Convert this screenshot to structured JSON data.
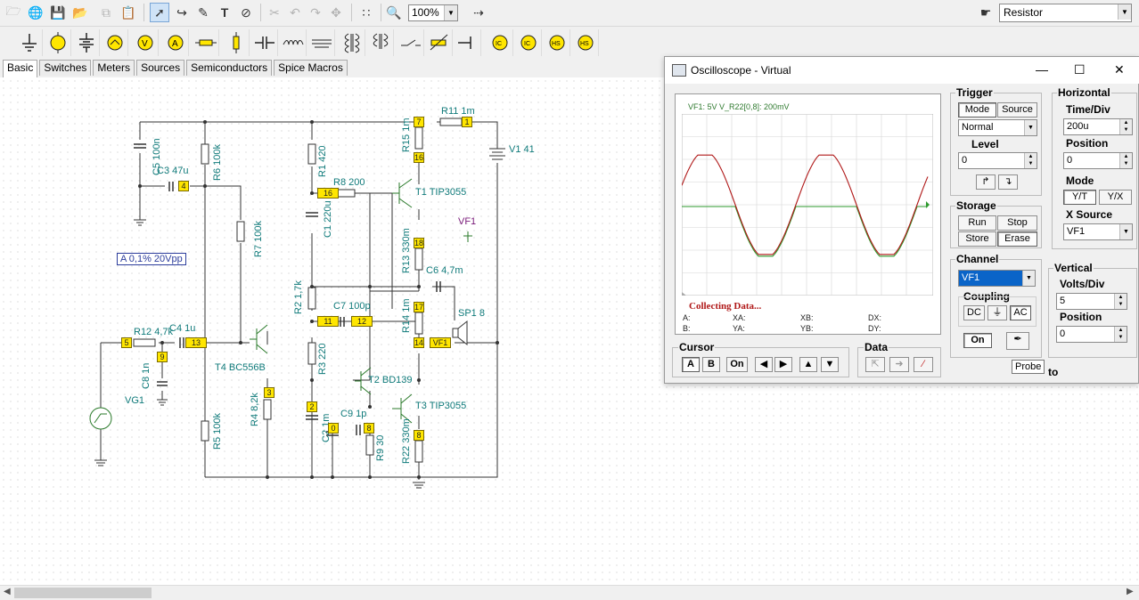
{
  "toolbar": {
    "zoom": "100%",
    "component_select": "Resistor",
    "icons": [
      "open-icon",
      "globe-icon",
      "save-icon",
      "open-folder-icon",
      "copy-icon",
      "paste-icon",
      "pointer-icon",
      "wire-icon",
      "pencil-icon",
      "text-icon",
      "no-wire-icon",
      "cut-icon",
      "undo-icon",
      "redo-icon",
      "pan-icon",
      "grid-icon",
      "zoom-icon",
      "marker-icon",
      "component-pick-icon"
    ]
  },
  "palette": {
    "items": [
      "ground-icon",
      "voltage-source-icon",
      "battery-icon",
      "ac-source-icon",
      "voltmeter-icon",
      "ammeter-icon",
      "resistor-icon",
      "potentiometer-icon",
      "capacitor-icon",
      "inductor-icon",
      "transformer-coil-icon",
      "transformer-icon",
      "transformer2-icon",
      "switch-icon",
      "variable-resistor-icon",
      "capacitor-polar-icon",
      "ic-icon",
      "ic2-icon",
      "hs-icon",
      "hs2-icon"
    ]
  },
  "tabs": [
    "Basic",
    "Switches",
    "Meters",
    "Sources",
    "Semiconductors",
    "Spice Macros"
  ],
  "schematic": {
    "source_label": "A 0,1% 20Vpp",
    "labels": [
      {
        "t": "R11 1m"
      },
      {
        "t": "V1 41"
      },
      {
        "t": "T1 TIP3055"
      },
      {
        "t": "R8 200"
      },
      {
        "t": "VF1"
      },
      {
        "t": "C6 4,7m"
      },
      {
        "t": "C7 100p"
      },
      {
        "t": "SP1 8"
      },
      {
        "t": "T4 BC556B"
      },
      {
        "t": "T2 BD139"
      },
      {
        "t": "T3 TIP3055"
      },
      {
        "t": "C9 1p"
      },
      {
        "t": "R12 4,7k"
      },
      {
        "t": "C4 1u"
      },
      {
        "t": "VG1"
      },
      {
        "t": "C3 47u"
      }
    ],
    "vlabels": [
      {
        "t": "C5 100n"
      },
      {
        "t": "R6 100k"
      },
      {
        "t": "R1 420"
      },
      {
        "t": "R15 1m"
      },
      {
        "t": "C1 220u"
      },
      {
        "t": "R7 100k"
      },
      {
        "t": "R13 330m"
      },
      {
        "t": "R2 1,7k"
      },
      {
        "t": "R14 1m"
      },
      {
        "t": "R3 220"
      },
      {
        "t": "R4 8,2k"
      },
      {
        "t": "R5 100k"
      },
      {
        "t": "C8 1n"
      },
      {
        "t": "R9 30"
      },
      {
        "t": "R22 330m"
      },
      {
        "t": "C2 1m"
      }
    ],
    "nodes": [
      "7",
      "1",
      "16",
      "16",
      "18",
      "17",
      "11",
      "12",
      "14",
      "VF1",
      "3",
      "2",
      "0",
      "8",
      "8",
      "5",
      "9",
      "13",
      "4"
    ]
  },
  "oscilloscope": {
    "title": "Oscilloscope - Virtual",
    "header": "VF1: 5V   V_R22[0,8]: 200mV",
    "status": "Collecting Data...",
    "readouts": {
      "a": "A:",
      "xa": "XA:",
      "xb": "XB:",
      "dx": "DX:",
      "b": "B:",
      "ya": "YA:",
      "yb": "YB:",
      "dy": "DY:"
    },
    "trigger": {
      "title": "Trigger",
      "mode": "Mode",
      "source": "Source",
      "normal": "Normal",
      "level_label": "Level",
      "level": "0"
    },
    "storage": {
      "title": "Storage",
      "run": "Run",
      "stop": "Stop",
      "store": "Store",
      "erase": "Erase"
    },
    "horizontal": {
      "title": "Horizontal",
      "time_label": "Time/Div",
      "time": "200u",
      "pos_label": "Position",
      "pos": "0",
      "mode_label": "Mode",
      "yt": "Y/T",
      "yx": "Y/X",
      "xsrc_label": "X Source",
      "xsrc": "VF1"
    },
    "channel": {
      "title": "Channel",
      "value": "VF1",
      "coupling": "Coupling",
      "dc": "DC",
      "ac": "AC",
      "on": "On"
    },
    "vertical": {
      "title": "Vertical",
      "vdiv_label": "Volts/Div",
      "vdiv": "5",
      "pos_label": "Position",
      "pos": "0"
    },
    "cursor": {
      "title": "Cursor",
      "a": "A",
      "b": "B",
      "on": "On"
    },
    "data": {
      "title": "Data"
    },
    "tooltip": "Probe",
    "auto_fragment": "to",
    "colors": {
      "vf1": "#b01818",
      "r22": "#2e9a2e"
    }
  }
}
